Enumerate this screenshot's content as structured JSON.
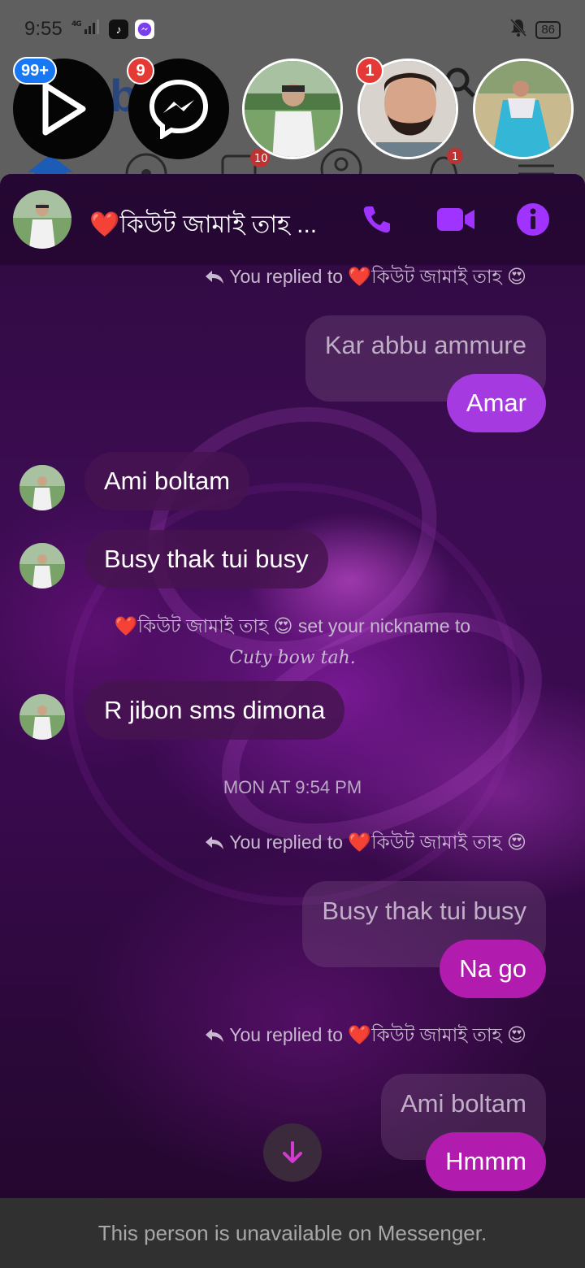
{
  "status_bar": {
    "time": "9:55",
    "signal": "4G",
    "battery": "86",
    "icons": [
      "tiktok-icon",
      "messenger-icon",
      "bell-off-icon"
    ]
  },
  "chat_heads": {
    "video_badge": "99+",
    "messenger_badge": "9",
    "person_badge": "1"
  },
  "header": {
    "contact_name": "❤️কিউট জামাই তাহ ...",
    "call_icon": "phone-icon",
    "video_icon": "video-camera-icon",
    "info_icon": "info-icon",
    "accent": "#a033ff"
  },
  "messages": {
    "reply_note_1": "You replied to ❤️কিউট জামাই তাহ 😍",
    "quote_1": "Kar abbu ammure",
    "out_1": "Amar",
    "in_1": "Ami boltam",
    "in_2": "Busy thak tui busy",
    "nick_note": "❤️কিউট জামাই তাহ 😍 set your nickname to",
    "nick_value": "Cuty bow tah.",
    "in_3": "R jibon sms dimona",
    "timestamp": "MON AT 9:54 PM",
    "reply_note_2": "You replied to ❤️কিউট জামাই তাহ 😍",
    "quote_2": "Busy thak tui busy",
    "out_2": "Na go",
    "reply_note_3": "You replied to ❤️কিউট জামাই তাহ 😍",
    "quote_3": "Ami boltam",
    "out_3": "Hmmm"
  },
  "colors": {
    "out_bubble_purple": "#a43ae0",
    "out_bubble_magenta": "#b21cae",
    "footer_bg": "#303030"
  },
  "footer": {
    "text": "This person is unavailable on Messenger."
  }
}
